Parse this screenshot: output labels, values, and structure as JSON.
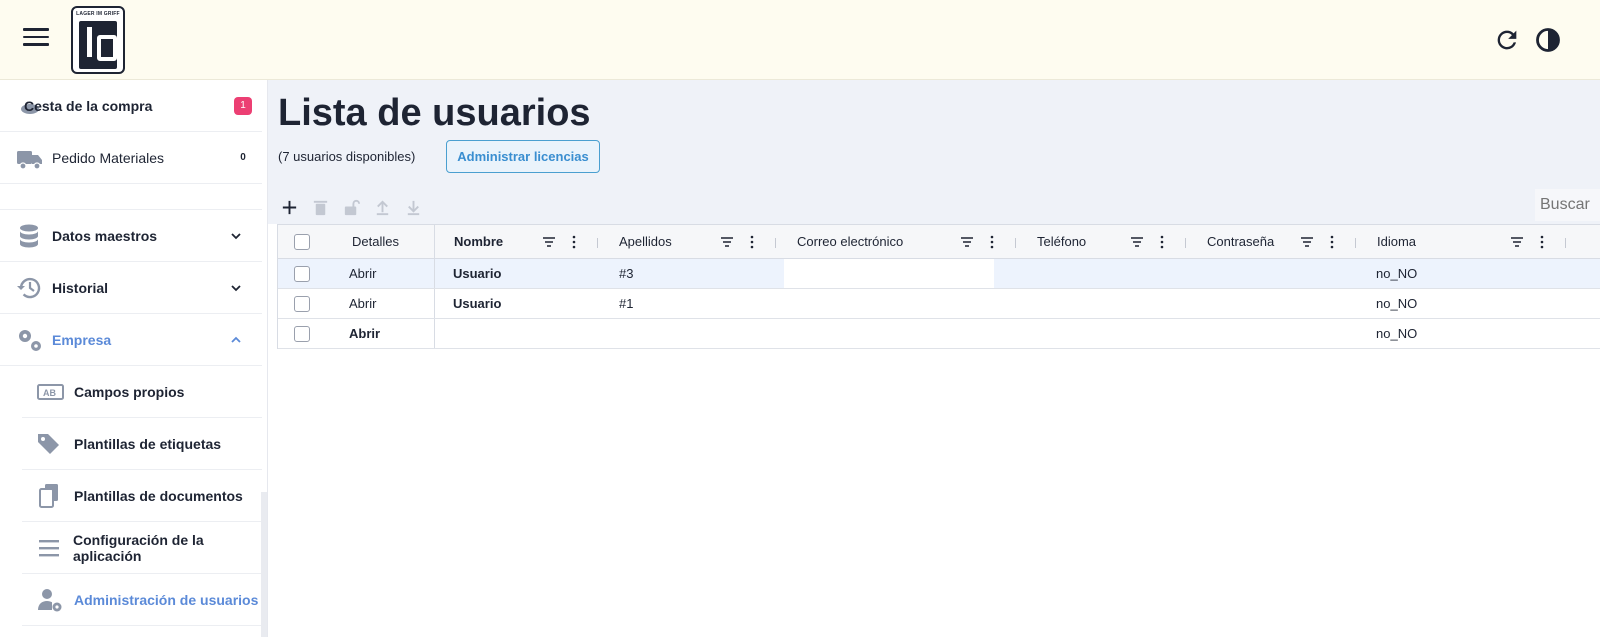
{
  "header": {
    "menu_icon": "hamburger-menu-icon",
    "logo_text": "LAGER IM GRIFF",
    "refresh_icon": "refresh-icon",
    "theme_icon": "contrast-theme-icon"
  },
  "sidebar": {
    "items": [
      {
        "label": "Cesta de la compra",
        "icon": "basket-icon",
        "badge": "1"
      },
      {
        "label": "Pedido Materiales",
        "icon": "truck-icon",
        "badge": "0"
      },
      {
        "label": "Datos maestros",
        "icon": "database-icon"
      },
      {
        "label": "Historial",
        "icon": "history-icon"
      },
      {
        "label": "Empresa",
        "icon": "gears-icon"
      },
      {
        "label": "Campos propios",
        "icon": "ab-field-icon"
      },
      {
        "label": "Plantillas de etiquetas",
        "icon": "tags-icon"
      },
      {
        "label": "Plantillas de documentos",
        "icon": "documents-icon"
      },
      {
        "label": "Configuración de la aplicación",
        "icon": "list-settings-icon"
      },
      {
        "label": "Administración de usuarios",
        "icon": "user-gear-icon"
      }
    ]
  },
  "main": {
    "title": "Lista de usuarios",
    "available_text": "(7 usuarios disponibles)",
    "licenses_button": "Administrar licencias",
    "search_placeholder": "Buscar",
    "toolbar": [
      "add-icon",
      "trash-icon",
      "unlock-icon",
      "upload-icon",
      "download-icon"
    ]
  },
  "table": {
    "columns": [
      "Detalles",
      "Nombre",
      "Apellidos",
      "Correo electrónico",
      "Teléfono",
      "Contraseña",
      "Idioma"
    ],
    "rows": [
      {
        "detail": "Abrir",
        "nombre": "Usuario",
        "apellidos": "#3",
        "correo": "",
        "telefono": "",
        "contrasena": "",
        "idioma": "no_NO"
      },
      {
        "detail": "Abrir",
        "nombre": "Usuario",
        "apellidos": "#1",
        "correo": "",
        "telefono": "",
        "contrasena": "",
        "idioma": "no_NO"
      },
      {
        "detail": "Abrir",
        "nombre": "",
        "apellidos": "",
        "correo": "",
        "telefono": "",
        "contrasena": "",
        "idioma": "no_NO"
      }
    ]
  },
  "colors": {
    "header_bg": "#fefcf0",
    "accent": "#5b8ad8",
    "badge": "#ec3f73",
    "button_border": "#4a9fd0"
  }
}
